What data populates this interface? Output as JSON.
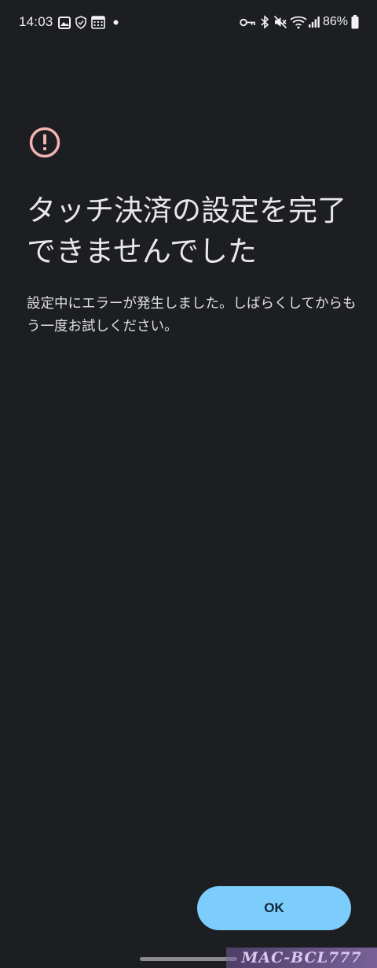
{
  "status_bar": {
    "time": "14:03",
    "battery_percent": "86%",
    "left_icons": [
      "gallery-icon",
      "shield-icon",
      "calendar-icon",
      "notification-dot-icon"
    ],
    "right_icons": [
      "key-icon",
      "bluetooth-icon",
      "mute-icon",
      "wifi-icon",
      "signal-icon",
      "battery-icon"
    ]
  },
  "dialog": {
    "icon": "alert-circle-icon",
    "icon_color": "#f3b3b3",
    "title": "タッチ決済の設定を完了できませんでした",
    "message": "設定中にエラーが発生しました。しばらくしてからもう一度お試しください。"
  },
  "actions": {
    "ok_label": "OK",
    "ok_color": "#7ccdfc"
  },
  "watermark": {
    "text": "MAC-BCL777"
  },
  "colors": {
    "background": "#1c1e22",
    "text": "#e8e8e8"
  }
}
